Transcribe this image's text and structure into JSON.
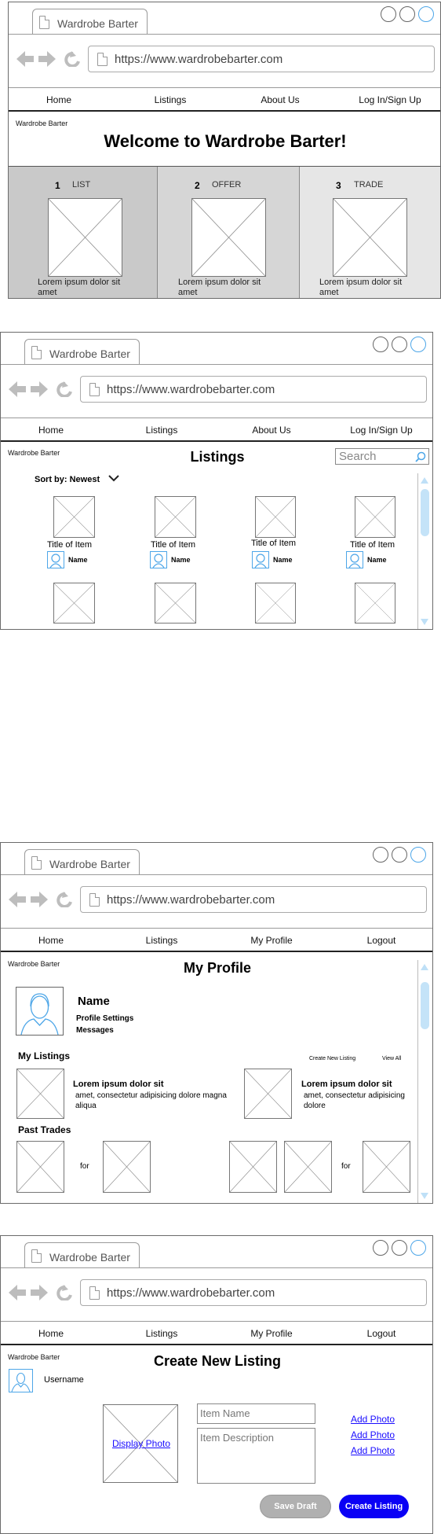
{
  "browser": {
    "tab_title": "Wardrobe Barter",
    "url": "https://www.wardrobebarter.com"
  },
  "brand": "Wardrobe Barter",
  "guest_nav": [
    "Home",
    "Listings",
    "About Us",
    "Log In/Sign Up"
  ],
  "member_nav": [
    "Home",
    "Listings",
    "My Profile",
    "Logout"
  ],
  "home": {
    "title": "Welcome to Wardrobe Barter!",
    "steps": [
      {
        "number": "1",
        "label": "LIST",
        "text": "Lorem ipsum dolor sit amet"
      },
      {
        "number": "2",
        "label": "OFFER",
        "text": "Lorem ipsum dolor sit amet"
      },
      {
        "number": "3",
        "label": "TRADE",
        "text": "Lorem ipsum dolor sit amet"
      }
    ]
  },
  "listings": {
    "title": "Listings",
    "search_placeholder": "Search",
    "sort_label": "Sort by: Newest",
    "items": [
      {
        "title": "Title of Item",
        "user": "Name"
      },
      {
        "title": "Title of Item",
        "user": "Name"
      },
      {
        "title": "Title of Item",
        "user": "Name"
      },
      {
        "title": "Title of Item",
        "user": "Name"
      }
    ]
  },
  "profile": {
    "title": "My Profile",
    "name": "Name",
    "settings_link": "Profile Settings",
    "messages_link": "Messages",
    "my_listings_heading": "My Listings",
    "create_new_listing": "Create New Listing",
    "view_all": "View All",
    "listings": [
      {
        "title": "Lorem ipsum dolor sit",
        "desc": "amet, consectetur adipisicing dolore magna aliqua"
      },
      {
        "title": "Lorem ipsum dolor sit",
        "desc": "amet, consectetur adipisicing dolore"
      }
    ],
    "past_trades_heading": "Past Trades",
    "for_word": "for"
  },
  "create": {
    "title": "Create New Listing",
    "username": "Username",
    "display_photo": "Display Photo",
    "item_name_placeholder": "Item Name",
    "item_desc_placeholder": "Item Description",
    "add_photo": [
      "Add Photo",
      "Add Photo",
      "Add Photo"
    ],
    "save_draft": "Save Draft",
    "create_listing": "Create Listing"
  },
  "colors": {
    "step1_bg": "#c9c9c9",
    "step2_bg": "#d6d6d6",
    "step3_bg": "#e6e6e6",
    "accent_blue": "#4da6e8",
    "create_button": "#0a00f5",
    "save_button": "#b0b0b0",
    "link": "#1a0dff"
  }
}
